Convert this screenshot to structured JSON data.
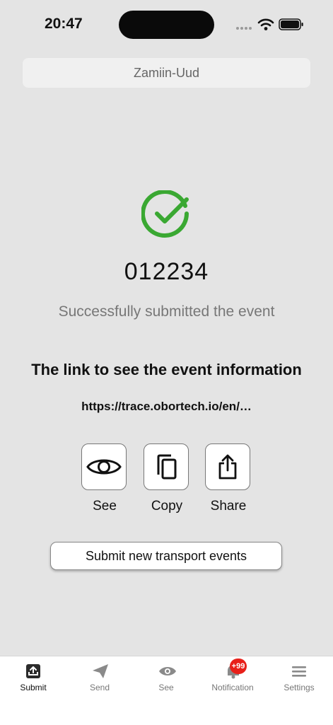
{
  "status_bar": {
    "time": "20:47"
  },
  "header": {
    "title": "Zamiin-Uud"
  },
  "result": {
    "event_id": "012234",
    "message": "Successfully submitted the event",
    "link_title": "The link to see the event information",
    "link_url": "https://trace.obortech.io/en/…"
  },
  "actions": [
    {
      "label": "See",
      "icon": "eye-icon"
    },
    {
      "label": "Copy",
      "icon": "copy-icon"
    },
    {
      "label": "Share",
      "icon": "share-icon"
    }
  ],
  "submit_new_label": "Submit new transport events",
  "tabbar": {
    "items": [
      {
        "label": "Submit",
        "icon": "upload-tray-icon",
        "active": true
      },
      {
        "label": "Send",
        "icon": "paper-plane-icon",
        "active": false
      },
      {
        "label": "See",
        "icon": "eye-icon",
        "active": false
      },
      {
        "label": "Notification",
        "icon": "bell-icon",
        "active": false
      },
      {
        "label": "Settings",
        "icon": "menu-icon",
        "active": false
      }
    ],
    "notification_badge": "+99"
  },
  "colors": {
    "success": "#3aa832",
    "badge": "#e8201a"
  }
}
